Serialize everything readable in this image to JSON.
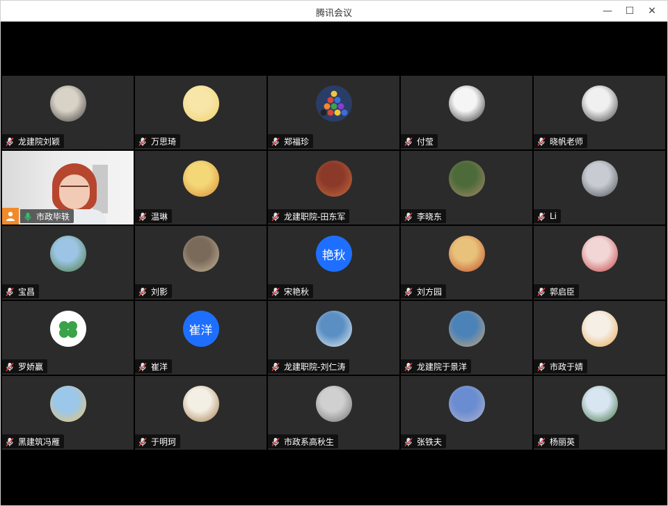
{
  "window": {
    "title": "腾讯会议"
  },
  "controls": {
    "minimize": "—",
    "maximize": "☐",
    "close": "✕"
  },
  "participants": [
    {
      "name": "龙建院刘颖",
      "avatar": "photo",
      "c1": "#d9d2c6",
      "c2": "#3b3b3b"
    },
    {
      "name": "万思琦",
      "avatar": "cartoon",
      "c1": "#f7e6a8",
      "c2": "#f2d06b"
    },
    {
      "name": "郑福珍",
      "avatar": "billiards",
      "c1": "#2a3d66",
      "c2": "#d9463a"
    },
    {
      "name": "付莹",
      "avatar": "anime",
      "c1": "#f5f5f5",
      "c2": "#2b2b2b"
    },
    {
      "name": "晓帆老师",
      "avatar": "photo",
      "c1": "#f0f0f0",
      "c2": "#3a3a3a"
    },
    {
      "name": "市政毕轶",
      "avatar": "video",
      "active": true
    },
    {
      "name": "温琳",
      "avatar": "cartoon",
      "c1": "#f4d777",
      "c2": "#d88b34"
    },
    {
      "name": "龙建职院-田东军",
      "avatar": "photo",
      "c1": "#8b3a2a",
      "c2": "#c76b3c"
    },
    {
      "name": "李晓东",
      "avatar": "photo",
      "c1": "#4d6b3a",
      "c2": "#a8896a"
    },
    {
      "name": "Li",
      "avatar": "photo",
      "c1": "#c8ccd2",
      "c2": "#4a4f56"
    },
    {
      "name": "宝昌",
      "avatar": "photo",
      "c1": "#9cc4e4",
      "c2": "#4a7a3a"
    },
    {
      "name": "刘影",
      "avatar": "photo",
      "c1": "#7a6a5a",
      "c2": "#c9b79a"
    },
    {
      "name": "宋艳秋",
      "avatar": "text",
      "initials": "艳秋",
      "c1": "#1e6fff"
    },
    {
      "name": "刘方园",
      "avatar": "photo",
      "c1": "#e8c27a",
      "c2": "#c24a2a"
    },
    {
      "name": "郭启臣",
      "avatar": "photo",
      "c1": "#f2d6d6",
      "c2": "#c23a3a"
    },
    {
      "name": "罗娇赢",
      "avatar": "clover",
      "c1": "#ffffff",
      "c2": "#3aa34a"
    },
    {
      "name": "崔洋",
      "avatar": "text",
      "initials": "崔洋",
      "c1": "#1e6fff"
    },
    {
      "name": "龙建职院-刘仁涛",
      "avatar": "photo",
      "c1": "#5b8fc4",
      "c2": "#e9eef2"
    },
    {
      "name": "龙建院于景洋",
      "avatar": "photo",
      "c1": "#4b82b8",
      "c2": "#c8a77a"
    },
    {
      "name": "市政于婧",
      "avatar": "photo",
      "c1": "#f5efe6",
      "c2": "#e8a64b"
    },
    {
      "name": "黑建筑冯雁",
      "avatar": "photo",
      "c1": "#9ac7ea",
      "c2": "#f0c46a"
    },
    {
      "name": "于明珂",
      "avatar": "photo",
      "c1": "#f4efe4",
      "c2": "#a07a4a"
    },
    {
      "name": "市政系高秋生",
      "avatar": "photo",
      "c1": "#d0d0d0",
      "c2": "#6e6e6e"
    },
    {
      "name": "张铁夫",
      "avatar": "photo",
      "c1": "#6a8cd0",
      "c2": "#b0b6cc"
    },
    {
      "name": "杨丽英",
      "avatar": "photo",
      "c1": "#d8e6f2",
      "c2": "#3c6e3a"
    }
  ]
}
